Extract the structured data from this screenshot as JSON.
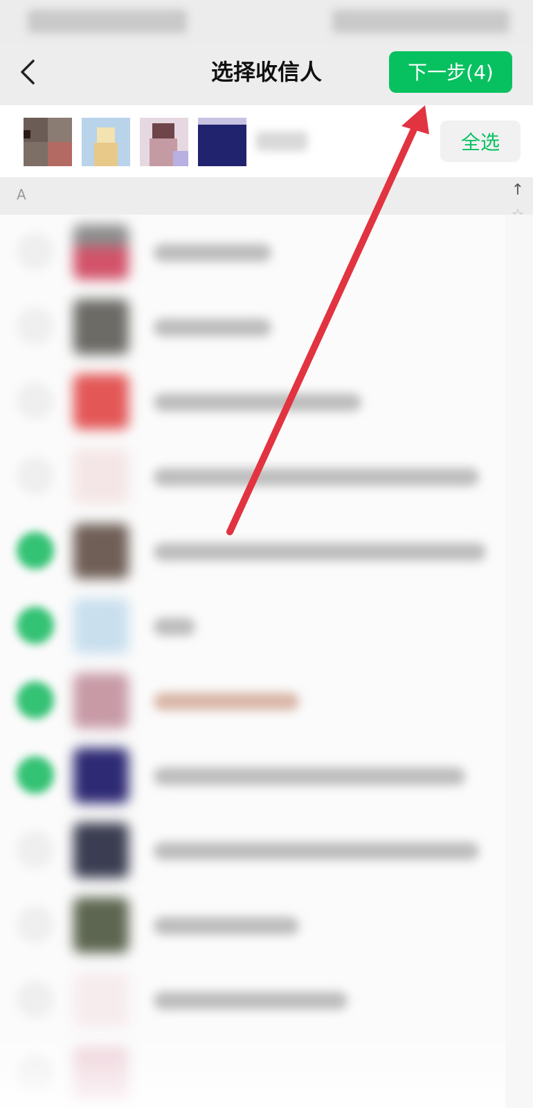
{
  "header": {
    "title": "选择收信人",
    "next_button_label": "下一步(4)",
    "back_icon": "chevron-left-icon"
  },
  "selected_recipients": {
    "count_selected": 4,
    "select_all_label": "全选"
  },
  "contacts": {
    "section_letter": "A",
    "index_bar": [
      "↑",
      "☆"
    ],
    "rows": [
      {
        "checked": false
      },
      {
        "checked": false
      },
      {
        "checked": false
      },
      {
        "checked": false
      },
      {
        "checked": true
      },
      {
        "checked": true
      },
      {
        "checked": true
      },
      {
        "checked": true
      },
      {
        "checked": false
      },
      {
        "checked": false
      },
      {
        "checked": false
      },
      {
        "checked": false
      }
    ]
  },
  "colors": {
    "accent": "#07c160",
    "annotation_arrow": "#e23340"
  }
}
